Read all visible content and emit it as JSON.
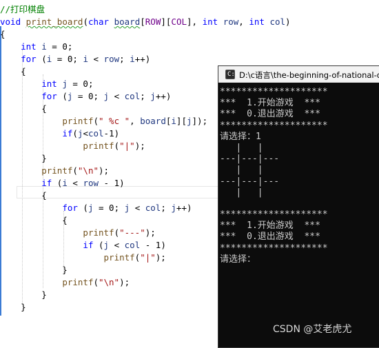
{
  "editor": {
    "lines": [
      {
        "segments": [
          {
            "t": "//打印棋盘",
            "c": "cm"
          }
        ]
      },
      {
        "segments": [
          {
            "t": "void",
            "c": "kw"
          },
          {
            "t": " "
          },
          {
            "t": "print_board",
            "c": "fn squig"
          },
          {
            "t": "("
          },
          {
            "t": "char",
            "c": "kw"
          },
          {
            "t": " "
          },
          {
            "t": "board",
            "c": "var squig"
          },
          {
            "t": "["
          },
          {
            "t": "ROW",
            "c": "mac"
          },
          {
            "t": "]["
          },
          {
            "t": "COL",
            "c": "mac"
          },
          {
            "t": "], "
          },
          {
            "t": "int",
            "c": "kw"
          },
          {
            "t": " "
          },
          {
            "t": "row",
            "c": "var"
          },
          {
            "t": ", "
          },
          {
            "t": "int",
            "c": "kw"
          },
          {
            "t": " "
          },
          {
            "t": "col",
            "c": "var"
          },
          {
            "t": ")"
          }
        ]
      },
      {
        "segments": [
          {
            "t": "{"
          }
        ]
      },
      {
        "segments": [
          {
            "t": "    "
          },
          {
            "t": "int",
            "c": "kw"
          },
          {
            "t": " "
          },
          {
            "t": "i",
            "c": "var"
          },
          {
            "t": " = 0;"
          }
        ]
      },
      {
        "segments": [
          {
            "t": "    "
          },
          {
            "t": "for",
            "c": "kw"
          },
          {
            "t": " ("
          },
          {
            "t": "i",
            "c": "var"
          },
          {
            "t": " = 0; "
          },
          {
            "t": "i",
            "c": "var"
          },
          {
            "t": " < "
          },
          {
            "t": "row",
            "c": "var"
          },
          {
            "t": "; "
          },
          {
            "t": "i",
            "c": "var"
          },
          {
            "t": "++)"
          }
        ]
      },
      {
        "segments": [
          {
            "t": "    {"
          }
        ]
      },
      {
        "segments": [
          {
            "t": "        "
          },
          {
            "t": "int",
            "c": "kw"
          },
          {
            "t": " "
          },
          {
            "t": "j",
            "c": "var"
          },
          {
            "t": " = 0;"
          }
        ]
      },
      {
        "segments": [
          {
            "t": "        "
          },
          {
            "t": "for",
            "c": "kw"
          },
          {
            "t": " ("
          },
          {
            "t": "j",
            "c": "var"
          },
          {
            "t": " = 0; "
          },
          {
            "t": "j",
            "c": "var"
          },
          {
            "t": " < "
          },
          {
            "t": "col",
            "c": "var"
          },
          {
            "t": "; "
          },
          {
            "t": "j",
            "c": "var"
          },
          {
            "t": "++)"
          }
        ]
      },
      {
        "segments": [
          {
            "t": "        {"
          }
        ]
      },
      {
        "segments": [
          {
            "t": "            "
          },
          {
            "t": "printf",
            "c": "fn"
          },
          {
            "t": "("
          },
          {
            "t": "\" %c \"",
            "c": "str"
          },
          {
            "t": ", "
          },
          {
            "t": "board",
            "c": "var"
          },
          {
            "t": "["
          },
          {
            "t": "i",
            "c": "var"
          },
          {
            "t": "]["
          },
          {
            "t": "j",
            "c": "var"
          },
          {
            "t": "]);"
          }
        ]
      },
      {
        "segments": [
          {
            "t": "            "
          },
          {
            "t": "if",
            "c": "kw"
          },
          {
            "t": "("
          },
          {
            "t": "j",
            "c": "var"
          },
          {
            "t": "<"
          },
          {
            "t": "col",
            "c": "var"
          },
          {
            "t": "-1)"
          }
        ]
      },
      {
        "segments": [
          {
            "t": "                "
          },
          {
            "t": "printf",
            "c": "fn"
          },
          {
            "t": "("
          },
          {
            "t": "\"|\"",
            "c": "str"
          },
          {
            "t": ");"
          }
        ]
      },
      {
        "segments": [
          {
            "t": "        }"
          }
        ]
      },
      {
        "segments": [
          {
            "t": "        "
          },
          {
            "t": "printf",
            "c": "fn"
          },
          {
            "t": "("
          },
          {
            "t": "\"\\n\"",
            "c": "str"
          },
          {
            "t": ");"
          }
        ]
      },
      {
        "segments": [
          {
            "t": "        "
          },
          {
            "t": "if",
            "c": "kw"
          },
          {
            "t": " ("
          },
          {
            "t": "i",
            "c": "var"
          },
          {
            "t": " < "
          },
          {
            "t": "row",
            "c": "var"
          },
          {
            "t": " - 1)"
          }
        ]
      },
      {
        "segments": [
          {
            "t": "        {"
          }
        ]
      },
      {
        "segments": [
          {
            "t": "            "
          },
          {
            "t": "for",
            "c": "kw"
          },
          {
            "t": " ("
          },
          {
            "t": "j",
            "c": "var"
          },
          {
            "t": " = 0; "
          },
          {
            "t": "j",
            "c": "var"
          },
          {
            "t": " < "
          },
          {
            "t": "col",
            "c": "var"
          },
          {
            "t": "; "
          },
          {
            "t": "j",
            "c": "var"
          },
          {
            "t": "++)"
          }
        ]
      },
      {
        "segments": [
          {
            "t": "            {"
          }
        ]
      },
      {
        "segments": [
          {
            "t": "                "
          },
          {
            "t": "printf",
            "c": "fn"
          },
          {
            "t": "("
          },
          {
            "t": "\"---\"",
            "c": "str"
          },
          {
            "t": ");"
          }
        ]
      },
      {
        "segments": [
          {
            "t": "                "
          },
          {
            "t": "if",
            "c": "kw"
          },
          {
            "t": " ("
          },
          {
            "t": "j",
            "c": "var"
          },
          {
            "t": " < "
          },
          {
            "t": "col",
            "c": "var"
          },
          {
            "t": " - 1)"
          }
        ]
      },
      {
        "segments": [
          {
            "t": "                    "
          },
          {
            "t": "printf",
            "c": "fn"
          },
          {
            "t": "("
          },
          {
            "t": "\"|\"",
            "c": "str"
          },
          {
            "t": ");"
          }
        ]
      },
      {
        "segments": [
          {
            "t": "            }"
          }
        ]
      },
      {
        "segments": [
          {
            "t": "            "
          },
          {
            "t": "printf",
            "c": "fn"
          },
          {
            "t": "("
          },
          {
            "t": "\"\\n\"",
            "c": "str"
          },
          {
            "t": ");"
          }
        ]
      },
      {
        "segments": [
          {
            "t": "        }"
          }
        ]
      },
      {
        "segments": [
          {
            "t": "    }"
          }
        ]
      }
    ]
  },
  "console": {
    "title": "D:\\c语言\\the-beginning-of-national-da",
    "icon": "console-app-icon",
    "output_lines": [
      "********************",
      "***  1.开始游戏  ***",
      "***  0.退出游戏  ***",
      "********************",
      "请选择：1",
      "   |   |   ",
      "---|---|---",
      "   |   |   ",
      "---|---|---",
      "   |   |   ",
      "",
      "********************",
      "***  1.开始游戏  ***",
      "***  0.退出游戏  ***",
      "********************",
      "请选择："
    ]
  },
  "watermark": "CSDN @艾老虎尤",
  "colors": {
    "keyword": "#0000ff",
    "string": "#a31515",
    "comment": "#008000",
    "function": "#74531f",
    "variable": "#1f377f",
    "macro": "#6f008a",
    "console_bg": "#0c0c0c",
    "console_fg": "#cccccc"
  }
}
